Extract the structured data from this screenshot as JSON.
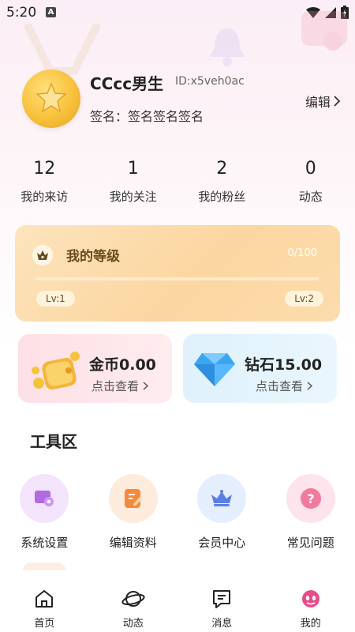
{
  "status_bar": {
    "time": "5:20",
    "badge": "A"
  },
  "profile": {
    "username": "CCcc男生",
    "user_id": "ID:x5veh0ac",
    "signature": "签名：签名签名签名",
    "edit_label": "编辑"
  },
  "stats": [
    {
      "value": "12",
      "label": "我的来访"
    },
    {
      "value": "1",
      "label": "我的关注"
    },
    {
      "value": "2",
      "label": "我的粉丝"
    },
    {
      "value": "0",
      "label": "动态"
    }
  ],
  "level": {
    "title": "我的等级",
    "progress_text": "0/100",
    "progress_fraction": 0,
    "current_level": "Lv:1",
    "next_level": "Lv:2"
  },
  "currency": {
    "coins": {
      "title": "金币0.00",
      "link": "点击查看"
    },
    "diamonds": {
      "title": "钻石15.00",
      "link": "点击查看"
    }
  },
  "tools": {
    "title": "工具区",
    "items": [
      {
        "label": "系统设置",
        "icon": "settings-monitor-icon"
      },
      {
        "label": "编辑资料",
        "icon": "edit-document-icon"
      },
      {
        "label": "会员中心",
        "icon": "crown-icon"
      },
      {
        "label": "常见问题",
        "icon": "question-icon"
      }
    ]
  },
  "nav": [
    {
      "label": "首页",
      "icon": "home-icon"
    },
    {
      "label": "动态",
      "icon": "planet-icon"
    },
    {
      "label": "消息",
      "icon": "message-icon"
    },
    {
      "label": "我的",
      "icon": "me-face-icon",
      "active": true
    }
  ],
  "colors": {
    "level_card": "#fbd6a0",
    "coin_card": "#fde0e6",
    "diamond_card": "#dff1fc",
    "accent_pink": "#e94b8a"
  }
}
